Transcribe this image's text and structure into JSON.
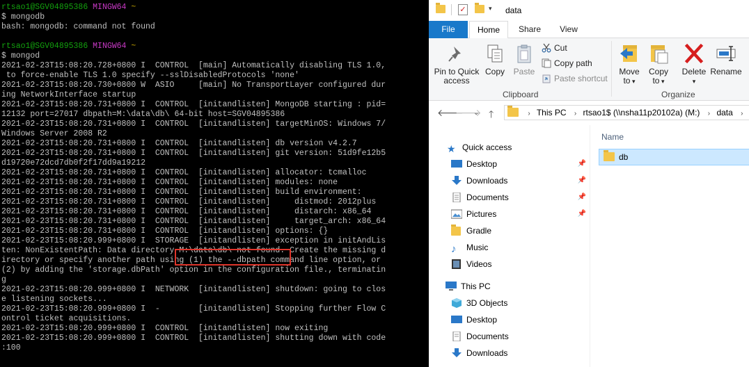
{
  "terminal": {
    "lines": [
      {
        "parts": [
          {
            "t": "rtsao1@SGV04895386",
            "c": "prompt-user"
          },
          {
            "t": " "
          },
          {
            "t": "MINGW64",
            "c": "prompt-host"
          },
          {
            "t": " "
          },
          {
            "t": "~",
            "c": "prompt-path"
          }
        ]
      },
      {
        "parts": [
          {
            "t": "$ mongodb"
          }
        ]
      },
      {
        "parts": [
          {
            "t": "bash: mongodb: command not found"
          }
        ]
      },
      {
        "parts": [
          {
            "t": ""
          }
        ]
      },
      {
        "parts": [
          {
            "t": "rtsao1@SGV04895386",
            "c": "prompt-user"
          },
          {
            "t": " "
          },
          {
            "t": "MINGW64",
            "c": "prompt-host"
          },
          {
            "t": " "
          },
          {
            "t": "~",
            "c": "prompt-path"
          }
        ]
      },
      {
        "parts": [
          {
            "t": "$ mongod"
          }
        ]
      },
      {
        "parts": [
          {
            "t": "2021-02-23T15:08:20.728+0800 I  CONTROL  [main] Automatically disabling TLS 1.0,"
          }
        ]
      },
      {
        "parts": [
          {
            "t": " to force-enable TLS 1.0 specify --sslDisabledProtocols 'none'"
          }
        ]
      },
      {
        "parts": [
          {
            "t": "2021-02-23T15:08:20.730+0800 W  ASIO     [main] No TransportLayer configured dur"
          }
        ]
      },
      {
        "parts": [
          {
            "t": "ing NetworkInterface startup"
          }
        ]
      },
      {
        "parts": [
          {
            "t": "2021-02-23T15:08:20.731+0800 I  CONTROL  [initandlisten] MongoDB starting : pid="
          }
        ]
      },
      {
        "parts": [
          {
            "t": "12132 port=27017 dbpath=M:\\data\\db\\ 64-bit host=SGV04895386"
          }
        ]
      },
      {
        "parts": [
          {
            "t": "2021-02-23T15:08:20.731+0800 I  CONTROL  [initandlisten] targetMinOS: Windows 7/"
          }
        ]
      },
      {
        "parts": [
          {
            "t": "Windows Server 2008 R2"
          }
        ]
      },
      {
        "parts": [
          {
            "t": "2021-02-23T15:08:20.731+0800 I  CONTROL  [initandlisten] db version v4.2.7"
          }
        ]
      },
      {
        "parts": [
          {
            "t": "2021-02-23T15:08:20.731+0800 I  CONTROL  [initandlisten] git version: 51d9fe12b5"
          }
        ]
      },
      {
        "parts": [
          {
            "t": "d19720e72dcd7db0f2f17dd9a19212"
          }
        ]
      },
      {
        "parts": [
          {
            "t": "2021-02-23T15:08:20.731+0800 I  CONTROL  [initandlisten] allocator: tcmalloc"
          }
        ]
      },
      {
        "parts": [
          {
            "t": "2021-02-23T15:08:20.731+0800 I  CONTROL  [initandlisten] modules: none"
          }
        ]
      },
      {
        "parts": [
          {
            "t": "2021-02-23T15:08:20.731+0800 I  CONTROL  [initandlisten] build environment:"
          }
        ]
      },
      {
        "parts": [
          {
            "t": "2021-02-23T15:08:20.731+0800 I  CONTROL  [initandlisten]     distmod: 2012plus"
          }
        ]
      },
      {
        "parts": [
          {
            "t": "2021-02-23T15:08:20.731+0800 I  CONTROL  [initandlisten]     distarch: x86_64"
          }
        ]
      },
      {
        "parts": [
          {
            "t": "2021-02-23T15:08:20.731+0800 I  CONTROL  [initandlisten]     target_arch: x86_64"
          }
        ]
      },
      {
        "parts": [
          {
            "t": "2021-02-23T15:08:20.731+0800 I  CONTROL  [initandlisten] options: {}"
          }
        ]
      },
      {
        "parts": [
          {
            "t": "2021-02-23T15:08:20.999+0800 I  STORAGE  [initandlisten] exception in initAndLis"
          }
        ]
      },
      {
        "parts": [
          {
            "t": "ten: NonExistentPath: Data directory M:\\data\\db\\ not found. Create the missing d"
          }
        ]
      },
      {
        "parts": [
          {
            "t": "irectory or specify another path using (1) the --dbpath command line option, or"
          }
        ]
      },
      {
        "parts": [
          {
            "t": "(2) by adding the 'storage.dbPath' option in the configuration file., terminatin"
          }
        ]
      },
      {
        "parts": [
          {
            "t": "g"
          }
        ]
      },
      {
        "parts": [
          {
            "t": "2021-02-23T15:08:20.999+0800 I  NETWORK  [initandlisten] shutdown: going to clos"
          }
        ]
      },
      {
        "parts": [
          {
            "t": "e listening sockets..."
          }
        ]
      },
      {
        "parts": [
          {
            "t": "2021-02-23T15:08:20.999+0800 I  -        [initandlisten] Stopping further Flow C"
          }
        ]
      },
      {
        "parts": [
          {
            "t": "ontrol ticket acquisitions."
          }
        ]
      },
      {
        "parts": [
          {
            "t": "2021-02-23T15:08:20.999+0800 I  CONTROL  [initandlisten] now exiting"
          }
        ]
      },
      {
        "parts": [
          {
            "t": "2021-02-23T15:08:20.999+0800 I  CONTROL  [initandlisten] shutting down with code"
          }
        ]
      },
      {
        "parts": [
          {
            "t": ":100"
          }
        ]
      }
    ],
    "highlight_color": "#e0352b"
  },
  "explorer": {
    "title": "data",
    "tabs": {
      "file": "File",
      "home": "Home",
      "share": "Share",
      "view": "View"
    },
    "ribbon": {
      "pin_label_1": "Pin to Quick",
      "pin_label_2": "access",
      "copy_label": "Copy",
      "paste_label": "Paste",
      "cut_label": "Cut",
      "copy_path_label": "Copy path",
      "paste_shortcut_label": "Paste shortcut",
      "clipboard_group": "Clipboard",
      "move_to_label": "Move",
      "move_to_label_2": "to",
      "copy_to_label": "Copy",
      "copy_to_label_2": "to",
      "delete_label": "Delete",
      "rename_label": "Rename",
      "organize_group": "Organize"
    },
    "address": {
      "crumbs": [
        "This PC",
        "rtsao1$ (\\\\nsha11p20102a) (M:)",
        "data"
      ]
    },
    "nav": {
      "quick_access": "Quick access",
      "items": [
        "Desktop",
        "Downloads",
        "Documents",
        "Pictures",
        "Gradle",
        "Music",
        "Videos"
      ],
      "this_pc": "This PC",
      "pc_items": [
        "3D Objects",
        "Desktop",
        "Documents",
        "Downloads"
      ]
    },
    "content": {
      "column_name": "Name",
      "rows": [
        "db"
      ]
    },
    "colors": {
      "file_tab": "#1979ca",
      "selection": "#cce8ff"
    }
  }
}
